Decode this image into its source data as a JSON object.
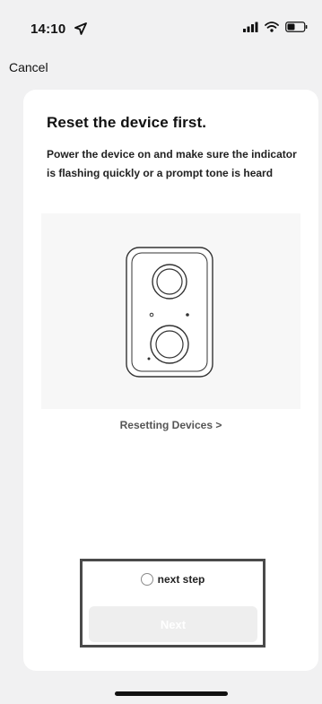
{
  "status_bar": {
    "time": "14:10",
    "icons": [
      "location-arrow-icon",
      "signal-icon",
      "wifi-icon",
      "battery-icon"
    ]
  },
  "nav": {
    "cancel_label": "Cancel"
  },
  "card": {
    "title": "Reset the device first.",
    "description": "Power the device on and make sure the indicator is flashing quickly or a prompt tone is heard",
    "illustration": "doorbell-camera-icon",
    "help_link": "Resetting Devices >"
  },
  "confirmation": {
    "checkbox_label": "next step",
    "checked": false,
    "next_button_label": "Next",
    "next_button_enabled": false
  },
  "colors": {
    "background": "#f1f1f2",
    "card": "#ffffff",
    "highlight_border": "#4a4a4a",
    "disabled_button": "#eeeeee"
  }
}
